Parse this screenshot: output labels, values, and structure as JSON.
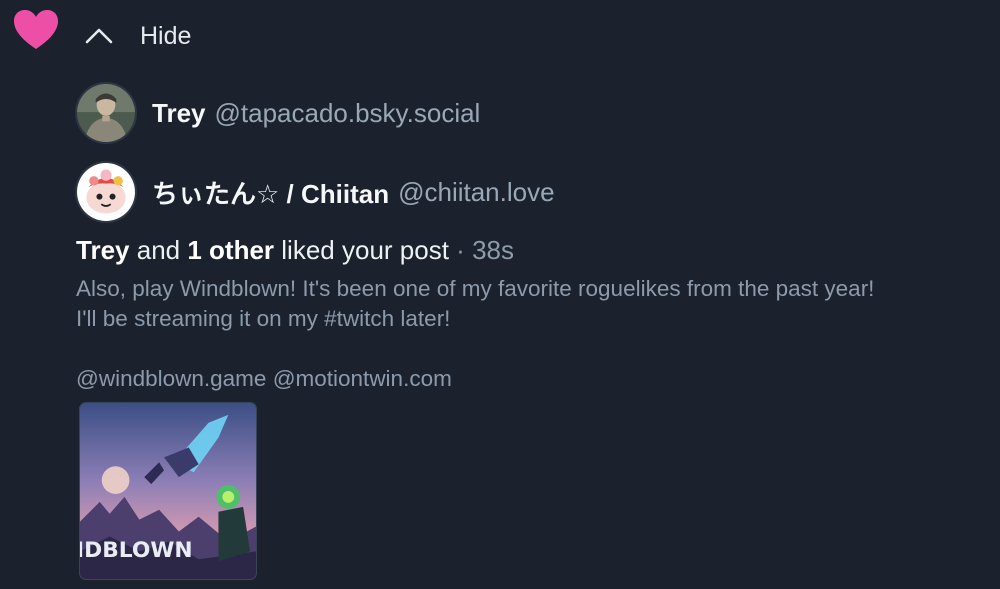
{
  "header": {
    "hide_label": "Hide",
    "icons": {
      "reaction": "heart-icon",
      "collapse": "chevron-up-icon"
    },
    "heart_color": "#ee4fa6"
  },
  "likers": [
    {
      "name": "Trey",
      "handle": "@tapacado.bsky.social"
    },
    {
      "name": "ちぃたん☆ / Chiitan",
      "handle": "@chiitan.love"
    }
  ],
  "notification": {
    "first_name": "Trey",
    "and_text": "and",
    "others_text": "1 other",
    "action_text": "liked your post",
    "separator": "·",
    "time": "38s"
  },
  "post": {
    "line1": "Also, play Windblown! It's been one of my favorite roguelikes from the past year!",
    "line2": "I'll be streaming it on my #twitch later!",
    "line3": "@windblown.game @motiontwin.com",
    "image_caption": "IDBLOWN"
  },
  "colors": {
    "background": "#1b222d",
    "muted_text": "#8d9aac",
    "handle_text": "#9aa7b6"
  }
}
